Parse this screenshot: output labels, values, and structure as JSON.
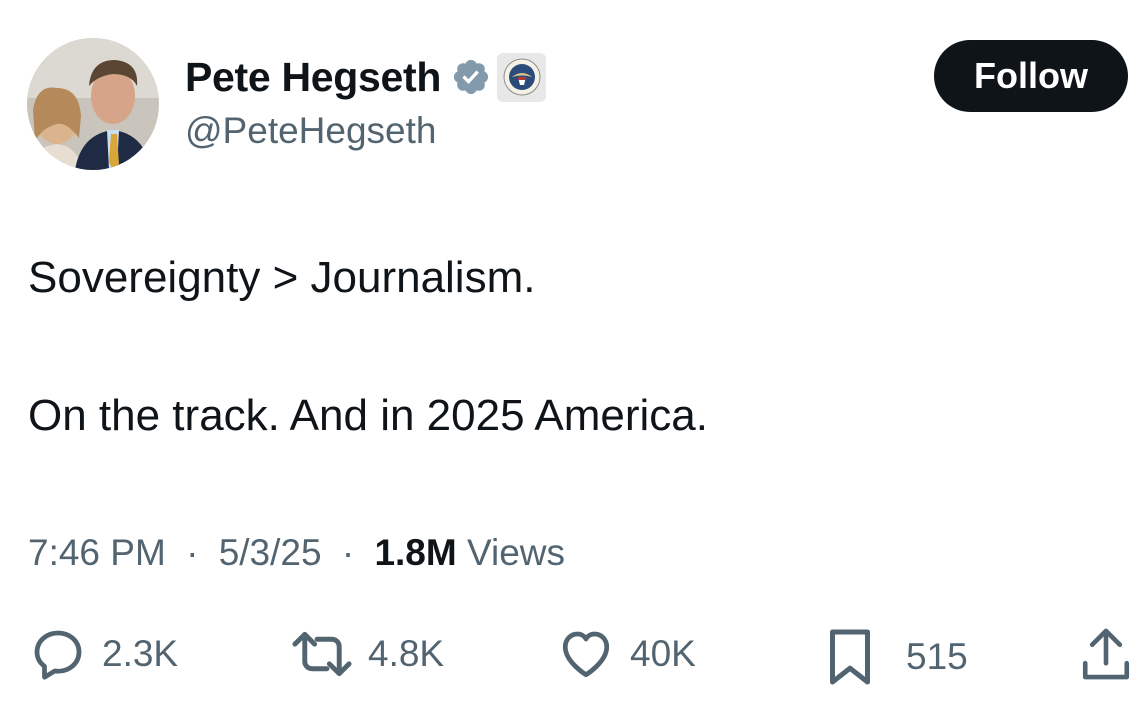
{
  "user": {
    "display_name": "Pete Hegseth",
    "handle": "@PeteHegseth",
    "verified": true,
    "affiliation_badge": "department-of-defense-seal-icon"
  },
  "follow_label": "Follow",
  "tweet": {
    "lines": [
      "Sovereignty > Journalism.",
      "On the track. And in 2025 America."
    ]
  },
  "meta": {
    "time": "7:46 PM",
    "separator": "·",
    "date": "5/3/25",
    "views_count": "1.8M",
    "views_label": "Views"
  },
  "actions": {
    "replies": "2.3K",
    "reposts": "4.8K",
    "likes": "40K",
    "bookmarks": "515"
  },
  "colors": {
    "text": "#0f1419",
    "secondary": "#536471",
    "verified_badge": "#829aab",
    "follow_bg": "#0f1419"
  }
}
